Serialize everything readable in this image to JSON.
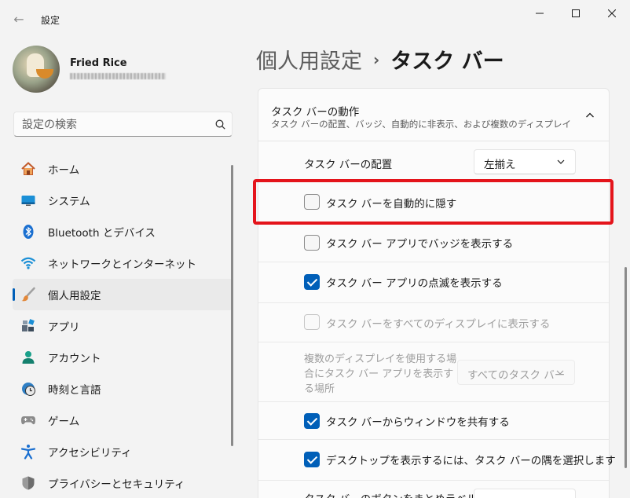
{
  "window": {
    "title": "設定",
    "back_icon": "back-arrow-icon"
  },
  "profile": {
    "name": "Fried Rice"
  },
  "search": {
    "placeholder": "設定の検索"
  },
  "nav": {
    "items": [
      {
        "label": "ホーム",
        "icon": "home-icon"
      },
      {
        "label": "システム",
        "icon": "system-icon"
      },
      {
        "label": "Bluetooth とデバイス",
        "icon": "bluetooth-icon"
      },
      {
        "label": "ネットワークとインターネット",
        "icon": "wifi-icon"
      },
      {
        "label": "個人用設定",
        "icon": "brush-icon",
        "active": true
      },
      {
        "label": "アプリ",
        "icon": "apps-icon"
      },
      {
        "label": "アカウント",
        "icon": "account-icon"
      },
      {
        "label": "時刻と言語",
        "icon": "clock-globe-icon"
      },
      {
        "label": "ゲーム",
        "icon": "gamepad-icon"
      },
      {
        "label": "アクセシビリティ",
        "icon": "accessibility-icon"
      },
      {
        "label": "プライバシーとセキュリティ",
        "icon": "shield-icon"
      }
    ]
  },
  "header": {
    "breadcrumb_parent": "個人用設定",
    "breadcrumb_separator": "›",
    "breadcrumb_current": "タスク バー"
  },
  "behaviors": {
    "title": "タスク バーの動作",
    "subtitle": "タスク バーの配置、バッジ、自動的に非表示、および複数のディスプレイ",
    "alignment_label": "タスク バーの配置",
    "alignment_value": "左揃え",
    "auto_hide_label": "タスク バーを自動的に隠す",
    "auto_hide_checked": false,
    "badges_label": "タスク バー アプリでバッジを表示する",
    "badges_checked": false,
    "flashing_label": "タスク バー アプリの点滅を表示する",
    "flashing_checked": true,
    "all_displays_label": "タスク バーをすべてのディスプレイに表示する",
    "all_displays_checked": false,
    "multi_display_label_line1": "複数のディスプレイを使用する場",
    "multi_display_label_line2": "合にタスク バー アプリを表示す",
    "multi_display_label_line3": "る場所",
    "multi_display_value": "すべてのタスク バー",
    "share_window_label": "タスク バーからウィンドウを共有する",
    "share_window_checked": true,
    "show_desktop_label": "デスクトップを表示するには、タスク バーの隅を選択します",
    "show_desktop_checked": true,
    "combine_buttons_label_partial": "タスク バーのボタンをまとめラベルを"
  },
  "colors": {
    "accent": "#005fb8",
    "highlight": "#e4141b"
  }
}
